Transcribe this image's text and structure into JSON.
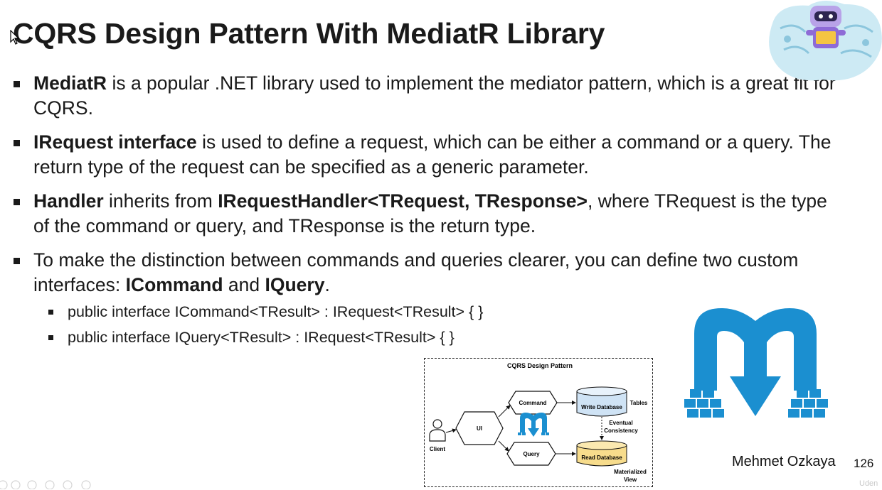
{
  "slide": {
    "title": "CQRS Design Pattern With MediatR Library",
    "bullets": [
      {
        "bold": "MediatR",
        "text": " is a popular .NET library used to implement the mediator pattern, which is a great fit for CQRS."
      },
      {
        "bold": "IRequest interface",
        "text": " is used to define a request, which can be either a command or a query. The return type of the request can be specified as a generic parameter."
      },
      {
        "bold": "Handler",
        "text1": " inherits from ",
        "bold2": "IRequestHandler<TRequest, TResponse>",
        "text2": ", where TRequest is the type of the command or query, and TResponse is the return type."
      },
      {
        "text1": "To make the distinction between commands and queries clearer, you can define two custom interfaces: ",
        "bold1": "ICommand",
        "text2": " and ",
        "bold2": "IQuery",
        "text3": "."
      }
    ],
    "sub_bullets": [
      "public interface ICommand<TResult> : IRequest<TResult> { }",
      "public interface IQuery<TResult> : IRequest<TResult> { }"
    ],
    "author": "Mehmet Ozkaya",
    "page_number": "126"
  },
  "diagram": {
    "title": "CQRS Design Pattern",
    "client": "Client",
    "ui": "UI",
    "command": "Command",
    "query": "Query",
    "write_db": "Write Database",
    "read_db": "Read Database",
    "tables": "Tables",
    "eventual_1": "Eventual",
    "eventual_2": "Consistency",
    "materialized_1": "Materialized",
    "materialized_2": "View"
  },
  "watermark": "Uden",
  "colors": {
    "logo_blue": "#1b8fd0",
    "text": "#1a1a1a",
    "write_db": "#cfe3f5",
    "read_db": "#f7dc8c"
  },
  "icons": [
    "cursor-icon",
    "robot-mascot",
    "mediatr-logo",
    "person-icon",
    "toolbar-icons"
  ]
}
